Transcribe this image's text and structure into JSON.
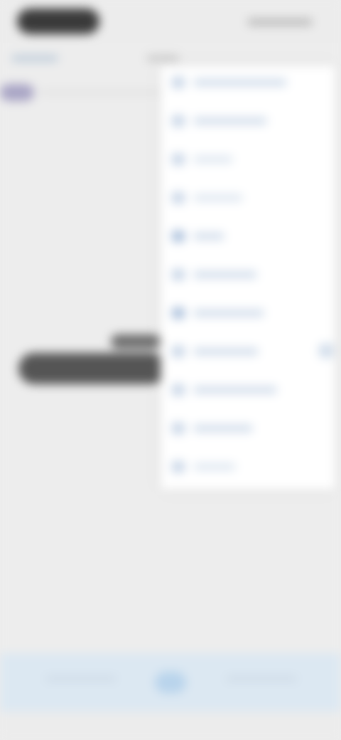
{
  "status_bar": {
    "time": "",
    "indicators": ""
  },
  "header": {
    "left_link": "",
    "center_title": "",
    "back_label": ""
  },
  "dropdown": {
    "items": [
      {
        "label": "",
        "icon": "menu-icon-1",
        "label_width": 132
      },
      {
        "label": "",
        "icon": "menu-icon-2",
        "label_width": 104
      },
      {
        "label": "",
        "icon": "menu-icon-3",
        "label_width": 56
      },
      {
        "label": "",
        "icon": "menu-icon-4",
        "label_width": 70
      },
      {
        "label": "",
        "icon": "menu-icon-5",
        "label_width": 44
      },
      {
        "label": "",
        "icon": "menu-icon-6",
        "label_width": 90
      },
      {
        "label": "",
        "icon": "menu-icon-7",
        "label_width": 100
      },
      {
        "label": "",
        "icon": "menu-icon-8",
        "label_width": 92
      },
      {
        "label": "",
        "icon": "menu-icon-9",
        "label_width": 118
      },
      {
        "label": "",
        "icon": "menu-icon-10",
        "label_width": 84
      },
      {
        "label": "",
        "icon": "menu-icon-11",
        "label_width": 60
      }
    ]
  },
  "toast": {
    "message": ""
  },
  "bottom_bar": {
    "left_label": "",
    "center_button": "",
    "right_label": ""
  },
  "colors": {
    "background": "#ededed",
    "menu_background": "#ffffff",
    "accent": "#b9d4ec",
    "toast": "#555555"
  }
}
